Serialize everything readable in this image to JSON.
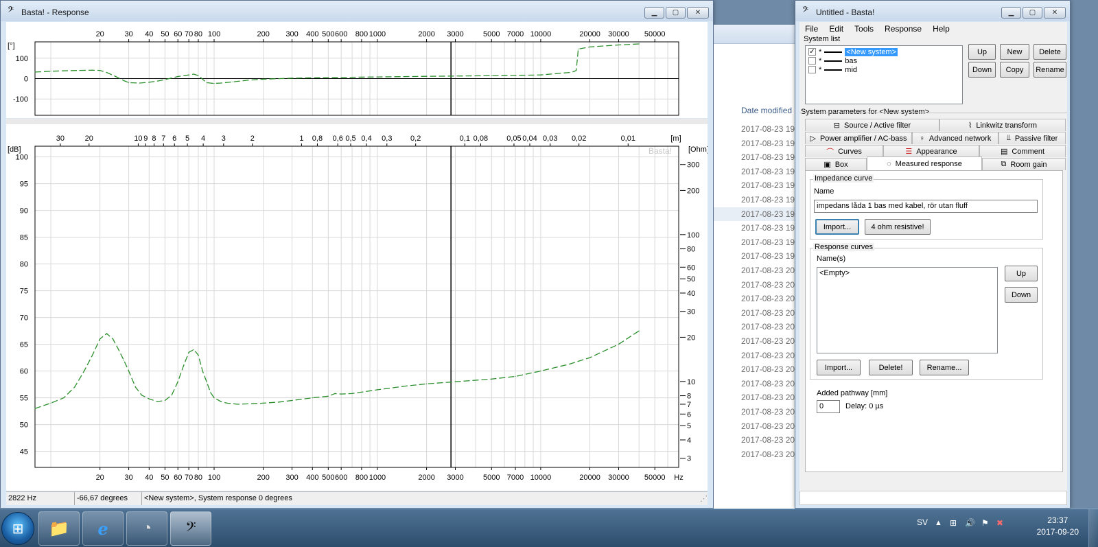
{
  "response_window": {
    "title": "Basta! - Response",
    "status": [
      "2822 Hz",
      "-66,67 degrees",
      "<New system>, System response 0 degrees"
    ]
  },
  "main_window": {
    "title": "Untitled - Basta!",
    "menu": [
      "File",
      "Edit",
      "Tools",
      "Response",
      "Help"
    ],
    "system_list_label": "System list",
    "systems": [
      {
        "name": "<New system>",
        "checked": true,
        "selected": true
      },
      {
        "name": "bas",
        "checked": false,
        "selected": false
      },
      {
        "name": "mid",
        "checked": false,
        "selected": false
      }
    ],
    "system_marker": "*",
    "check_mark": "✓",
    "buttons": {
      "up": "Up",
      "new": "New",
      "delete": "Delete",
      "down": "Down",
      "copy": "Copy",
      "rename": "Rename"
    },
    "params_label": "System parameters for <New system>",
    "tabs": {
      "source": "Source / Active filter",
      "linkwitz": "Linkwitz transform",
      "power": "Power amplifier / AC-bass",
      "advanced": "Advanced network",
      "passive": "Passive filter",
      "curves": "Curves",
      "appearance": "Appearance",
      "comment": "Comment",
      "box": "Box",
      "measured": "Measured response",
      "room": "Room gain"
    },
    "impedance": {
      "group_label": "Impedance curve",
      "name_label": "Name",
      "name_value": "impedans låda 1 bas med kabel, rör utan fluff",
      "import": "Import...",
      "resistive": "4 ohm resistive!"
    },
    "response": {
      "group_label": "Response curves",
      "names_label": "Name(s)",
      "list_item": "<Empty>",
      "up": "Up",
      "down": "Down",
      "import": "Import...",
      "delete": "Delete!",
      "rename": "Rename..."
    },
    "pathway": {
      "label": "Added pathway [mm]",
      "value": "0",
      "delay": "Delay: 0 µs"
    }
  },
  "explorer": {
    "column_header": "Date modified",
    "rows": [
      "2017-08-23 19:",
      "2017-08-23 19:",
      "2017-08-23 19:",
      "2017-08-23 19:",
      "2017-08-23 19:",
      "2017-08-23 19:",
      "2017-08-23 19:",
      "2017-08-23 19:",
      "2017-08-23 19:",
      "2017-08-23 19:",
      "2017-08-23 20:",
      "2017-08-23 20:",
      "2017-08-23 20:",
      "2017-08-23 20:",
      "2017-08-23 20:",
      "2017-08-23 20:",
      "2017-08-23 20:",
      "2017-08-23 20:",
      "2017-08-23 20:",
      "2017-08-23 20:",
      "2017-08-23 20:",
      "2017-08-23 20:",
      "2017-08-23 20:",
      "2017-08-23 20:"
    ]
  },
  "taskbar": {
    "start_glyph": "⊞",
    "apps": [
      {
        "name": "explorer",
        "glyph": "📁"
      },
      {
        "name": "internet-explorer",
        "glyph": "e"
      },
      {
        "name": "gauge-app",
        "glyph": "◔"
      },
      {
        "name": "basta",
        "glyph": "𝄢"
      }
    ],
    "language": "SV",
    "time": "23:37",
    "date": "2017-09-20"
  },
  "chart_data": [
    {
      "type": "line",
      "name": "phase",
      "xscale": "log",
      "xlim": [
        8,
        70000
      ],
      "ylabel": "[°]",
      "yticks": [
        100,
        0,
        -100
      ],
      "ylim": [
        -180,
        180
      ],
      "top_freq_ticks": [
        "20",
        "30",
        "40",
        "50",
        "60",
        "70",
        "80",
        "100",
        "200",
        "300",
        "400",
        "500",
        "600",
        "800",
        "1000",
        "2000",
        "3000",
        "5000",
        "7000",
        "10000",
        "20000",
        "30000",
        "50000"
      ],
      "cursor_hz": 2822,
      "color": "#2a8f2a",
      "series": [
        {
          "x": [
            8,
            10,
            12,
            15,
            18,
            20,
            22,
            25,
            28,
            30,
            35,
            40,
            45,
            50,
            60,
            70,
            75,
            80,
            90,
            100,
            110,
            130,
            160,
            200,
            300,
            500,
            1000,
            2000,
            5000,
            10000,
            15000,
            16000,
            16500,
            17000,
            20000,
            30000,
            40000
          ],
          "y": [
            32,
            36,
            38,
            40,
            41,
            40,
            30,
            10,
            -10,
            -20,
            -22,
            -18,
            -12,
            -5,
            10,
            18,
            22,
            15,
            -20,
            -24,
            -22,
            -16,
            -8,
            -3,
            2,
            5,
            8,
            11,
            14,
            18,
            30,
            35,
            40,
            145,
            155,
            165,
            170
          ]
        }
      ]
    },
    {
      "type": "line",
      "name": "magnitude",
      "xscale": "log",
      "xlim": [
        8,
        70000
      ],
      "ylim": [
        42,
        102
      ],
      "ylabel": "[dB]",
      "y2label": "[Ohm]",
      "yticks": [
        100,
        95,
        90,
        85,
        80,
        75,
        70,
        65,
        60,
        55,
        50,
        45
      ],
      "ohm_ticks": [
        300,
        200,
        100,
        80,
        60,
        50,
        40,
        30,
        20,
        10,
        8,
        7,
        6,
        5,
        4,
        3
      ],
      "bottom_freq_ticks": [
        "20",
        "30",
        "40",
        "50",
        "60",
        "70",
        "80",
        "100",
        "200",
        "300",
        "400",
        "500",
        "600",
        "800",
        "1000",
        "2000",
        "3000",
        "5000",
        "7000",
        "10000",
        "20000",
        "30000",
        "50000"
      ],
      "x_unit": "Hz",
      "wavelength_unit": "[m]",
      "wavelength_ticks": [
        "30",
        "20",
        "10",
        "9",
        "8",
        "7",
        "6",
        "5",
        "4",
        "3",
        "2",
        "1",
        "0,8",
        "0,6",
        "0,5",
        "0,4",
        "0,3",
        "0,2",
        "0,1",
        "0,08",
        "0,05",
        "0,04",
        "0,03",
        "0,02",
        "0,01"
      ],
      "cursor_hz": 2822,
      "watermark": "Basta!",
      "color": "#2a8f2a",
      "series": [
        {
          "x": [
            8,
            10,
            12,
            14,
            16,
            18,
            20,
            22,
            24,
            26,
            28,
            30,
            33,
            36,
            40,
            45,
            50,
            55,
            60,
            65,
            70,
            75,
            80,
            85,
            90,
            95,
            100,
            110,
            120,
            140,
            170,
            200,
            250,
            300,
            400,
            500,
            550,
            600,
            700,
            1000,
            1500,
            2000,
            3000,
            5000,
            7000,
            10000,
            15000,
            20000,
            30000,
            40000
          ],
          "y": [
            53,
            54,
            55,
            57,
            60,
            63,
            66,
            67,
            66,
            64,
            62,
            60,
            57,
            55.5,
            54.8,
            54.3,
            54.5,
            55.5,
            58,
            61,
            63.5,
            64,
            63,
            60,
            58,
            56,
            55,
            54.3,
            54,
            53.8,
            53.9,
            54,
            54.2,
            54.5,
            55,
            55.3,
            55.8,
            55.7,
            55.8,
            56.5,
            57.2,
            57.6,
            58,
            58.5,
            59,
            60,
            61.3,
            62.5,
            65,
            67.5
          ]
        }
      ]
    }
  ]
}
